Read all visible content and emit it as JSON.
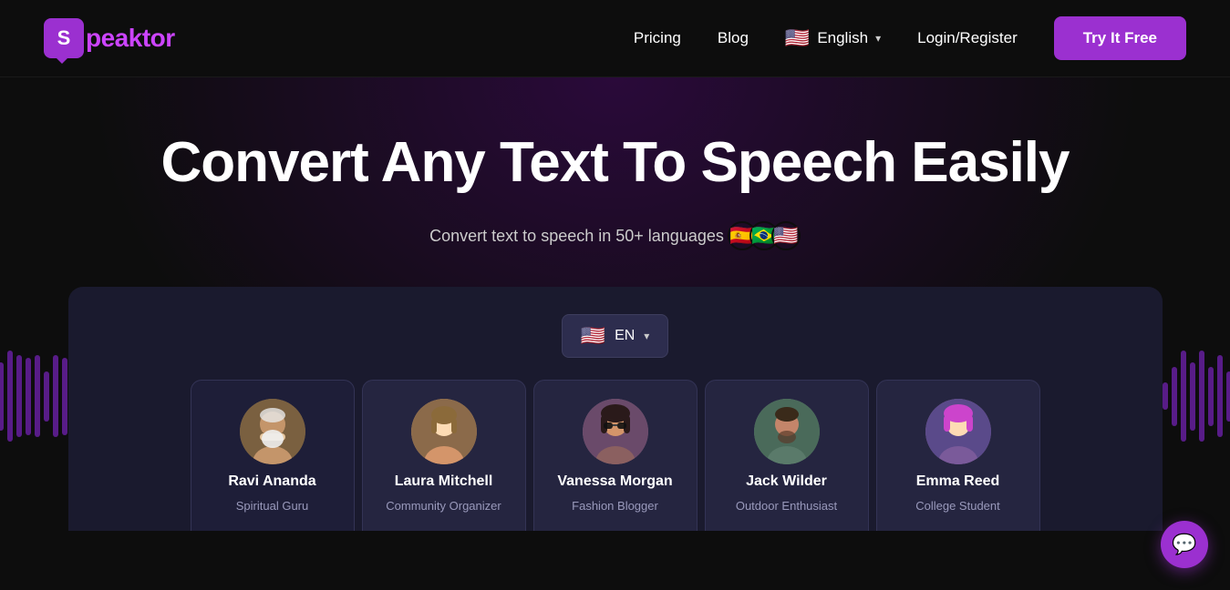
{
  "brand": {
    "logo_letter": "S",
    "logo_name": "peaktor"
  },
  "navbar": {
    "pricing_label": "Pricing",
    "blog_label": "Blog",
    "language_label": "English",
    "login_label": "Login/Register",
    "try_free_label": "Try It Free"
  },
  "hero": {
    "title": "Convert Any Text To Speech Easily",
    "subtitle": "Convert text to speech in 50+ languages",
    "flags": [
      "🇪🇸",
      "🇧🇷",
      "🇺🇸"
    ]
  },
  "app": {
    "language_selector": "EN",
    "flag_emoji": "🇺🇸"
  },
  "voices": [
    {
      "name": "Ravi Ananda",
      "role": "Spiritual Guru",
      "avatar_class": "avatar-ravi",
      "avatar_emoji": "🧙"
    },
    {
      "name": "Laura Mitchell",
      "role": "Community Organizer",
      "avatar_class": "avatar-laura",
      "avatar_emoji": "👩"
    },
    {
      "name": "Vanessa Morgan",
      "role": "Fashion Blogger",
      "avatar_class": "avatar-vanessa",
      "avatar_emoji": "👩‍🦱"
    },
    {
      "name": "Jack Wilder",
      "role": "Outdoor Enthusiast",
      "avatar_class": "avatar-jack",
      "avatar_emoji": "🧔"
    },
    {
      "name": "Emma Reed",
      "role": "College Student",
      "avatar_class": "avatar-emma",
      "avatar_emoji": "👩‍🦰"
    }
  ],
  "chat": {
    "icon": "💬"
  },
  "wave_bars": [
    4,
    6,
    8,
    5,
    9,
    7,
    10,
    6,
    8,
    5,
    7,
    9,
    6,
    8,
    5
  ]
}
